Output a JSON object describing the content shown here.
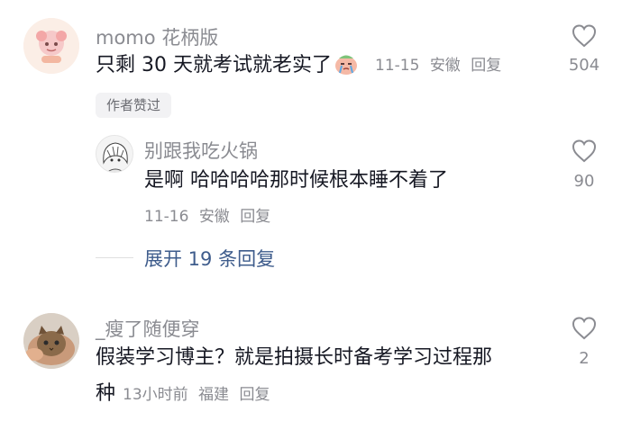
{
  "comments": [
    {
      "username": "momo 花柄版",
      "text_before_emoji": "只剩 30 天就考试就老实了",
      "emoji": "crying-face-emoji",
      "date": "11-15",
      "location": "安徽",
      "reply_label": "回复",
      "likes": "504",
      "badge": "作者赞过"
    },
    {
      "username": "别跟我吃火锅",
      "text": "是啊 哈哈哈哈那时候根本睡不着了",
      "date": "11-16",
      "location": "安徽",
      "reply_label": "回复",
      "likes": "90"
    },
    {
      "username": "_瘦了随便穿",
      "text_line1": "假装学习博主？就是拍摄长时备考学习过程那",
      "text_line2": "种",
      "date": "13小时前",
      "location": "福建",
      "reply_label": "回复",
      "likes": "2"
    }
  ],
  "expand_replies": "展开 19 条回复",
  "icons": {
    "like": "heart-outline-icon"
  },
  "colors": {
    "text": "#161823",
    "muted": "#8a8b91",
    "link": "#3e5c8c"
  }
}
